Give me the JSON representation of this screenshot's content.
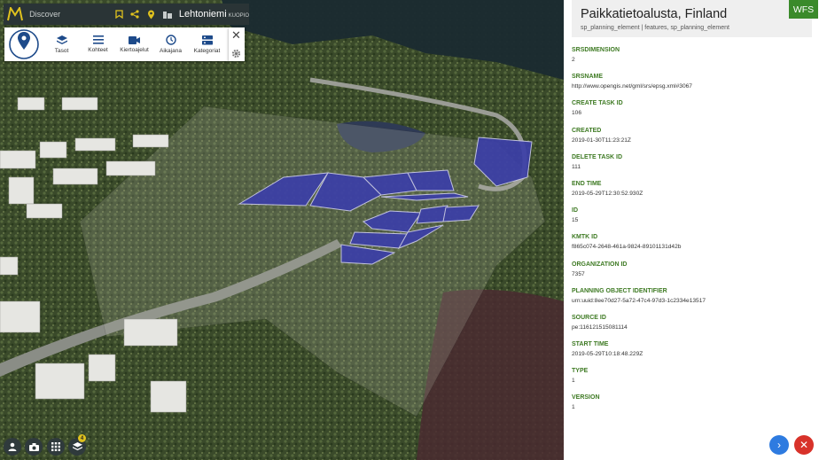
{
  "topbar": {
    "discover_placeholder": "Discover",
    "place_name": "Lehtoniemi",
    "place_sub": "KUOPIO",
    "icons": [
      "bookmark-icon",
      "share-icon",
      "location-pin-icon",
      "building-icon"
    ]
  },
  "tools": {
    "items": [
      {
        "label": "Tasot",
        "icon": "layers-icon"
      },
      {
        "label": "Kohteet",
        "icon": "list-icon"
      },
      {
        "label": "Kiertoajelut",
        "icon": "video-camera-icon"
      },
      {
        "label": "Aikajana",
        "icon": "clock-icon"
      },
      {
        "label": "Kategoriat",
        "icon": "categories-icon"
      }
    ]
  },
  "bottom_left": {
    "badge_count": "4"
  },
  "panel": {
    "title": "Paikkatietoalusta, Finland",
    "subtitle": "sp_planning_element   |   features, sp_planning_element",
    "badge": "WFS",
    "fields": [
      {
        "label": "SRSDIMENSION",
        "value": "2"
      },
      {
        "label": "SRSNAME",
        "value": "http://www.opengis.net/gml/srs/epsg.xml#3067"
      },
      {
        "label": "CREATE TASK ID",
        "value": "106"
      },
      {
        "label": "CREATED",
        "value": "2019-01-30T11:23:21Z"
      },
      {
        "label": "DELETE TASK ID",
        "value": "111"
      },
      {
        "label": "END TIME",
        "value": "2019-05-29T12:30:52.930Z"
      },
      {
        "label": "ID",
        "value": "15"
      },
      {
        "label": "KMTK ID",
        "value": "f865c074-2648-461a-9824-89101131d42b"
      },
      {
        "label": "ORGANIZATION ID",
        "value": "7357"
      },
      {
        "label": "PLANNING OBJECT IDENTIFIER",
        "value": "urn:uuid:8ee70d27-5a72-47c4-97d3-1c2334e13517"
      },
      {
        "label": "SOURCE ID",
        "value": "pe:116121515081114"
      },
      {
        "label": "START TIME",
        "value": "2019-05-29T10:18:48.229Z"
      },
      {
        "label": "TYPE",
        "value": "1"
      },
      {
        "label": "VERSION",
        "value": "1"
      }
    ]
  },
  "colors": {
    "accent_green": "#3e7a23",
    "planning_area": "#3c3fa8",
    "next_button": "#2e7be0",
    "close_button": "#d8322a"
  }
}
